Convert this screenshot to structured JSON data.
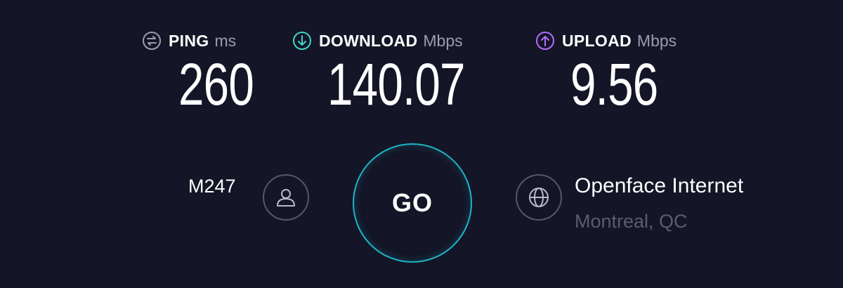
{
  "metrics": {
    "ping": {
      "label": "PING",
      "unit": "ms",
      "value": "260",
      "icon": "ping-icon",
      "color": "#9b9caf"
    },
    "download": {
      "label": "DOWNLOAD",
      "unit": "Mbps",
      "value": "140.07",
      "icon": "download-arrow-icon",
      "color": "#3ed6c8"
    },
    "upload": {
      "label": "UPLOAD",
      "unit": "Mbps",
      "value": "9.56",
      "icon": "upload-arrow-icon",
      "color": "#b46cff"
    }
  },
  "user": {
    "name": "M247",
    "icon": "user-icon"
  },
  "go_button": {
    "label": "GO",
    "accent": "#1cb5c6"
  },
  "isp": {
    "name": "Openface Internet",
    "location": "Montreal, QC",
    "icon": "globe-icon"
  }
}
